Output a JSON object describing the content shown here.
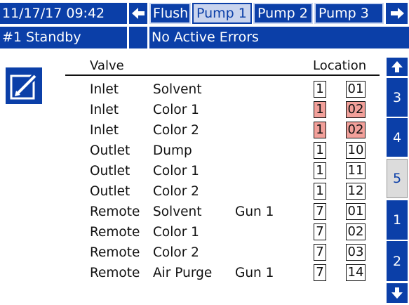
{
  "header": {
    "datetime": "11/17/17 09:42",
    "tabs": [
      {
        "label": "Flush"
      },
      {
        "label": "Pump 1",
        "active": true
      },
      {
        "label": "Pump 2"
      },
      {
        "label": "Pump 3"
      }
    ]
  },
  "status": {
    "pump_status": "#1 Standby",
    "errors": "No Active Errors"
  },
  "table": {
    "col_valve": "Valve",
    "col_location": "Location",
    "rows": [
      {
        "type": "Inlet",
        "material": "Solvent",
        "gun": "",
        "loc1": "1",
        "loc2": "01",
        "error": false
      },
      {
        "type": "Inlet",
        "material": "Color 1",
        "gun": "",
        "loc1": "1",
        "loc2": "02",
        "error": true
      },
      {
        "type": "Inlet",
        "material": "Color 2",
        "gun": "",
        "loc1": "1",
        "loc2": "02",
        "error": true
      },
      {
        "type": "Outlet",
        "material": "Dump",
        "gun": "",
        "loc1": "1",
        "loc2": "10",
        "error": false
      },
      {
        "type": "Outlet",
        "material": "Color 1",
        "gun": "",
        "loc1": "1",
        "loc2": "11",
        "error": false
      },
      {
        "type": "Outlet",
        "material": "Color 2",
        "gun": "",
        "loc1": "1",
        "loc2": "12",
        "error": false
      },
      {
        "type": "Remote",
        "material": "Solvent",
        "gun": "Gun 1",
        "loc1": "7",
        "loc2": "01",
        "error": false
      },
      {
        "type": "Remote",
        "material": "Color 1",
        "gun": "",
        "loc1": "7",
        "loc2": "02",
        "error": false
      },
      {
        "type": "Remote",
        "material": "Color 2",
        "gun": "",
        "loc1": "7",
        "loc2": "03",
        "error": false
      },
      {
        "type": "Remote",
        "material": "Air Purge",
        "gun": "Gun 1",
        "loc1": "7",
        "loc2": "14",
        "error": false
      }
    ]
  },
  "sidebar": {
    "pages": [
      "3",
      "4",
      "5",
      "1",
      "2"
    ],
    "active_page": "5"
  },
  "icons": {
    "nav_left": "arrow-left-icon",
    "nav_right": "arrow-right-icon",
    "scroll_up": "arrow-up-icon",
    "scroll_down": "arrow-down-icon",
    "edit": "edit-icon"
  },
  "colors": {
    "primary": "#0b3fa8",
    "error_cell": "#f2a09a",
    "active_tab": "#c9d4ee"
  }
}
